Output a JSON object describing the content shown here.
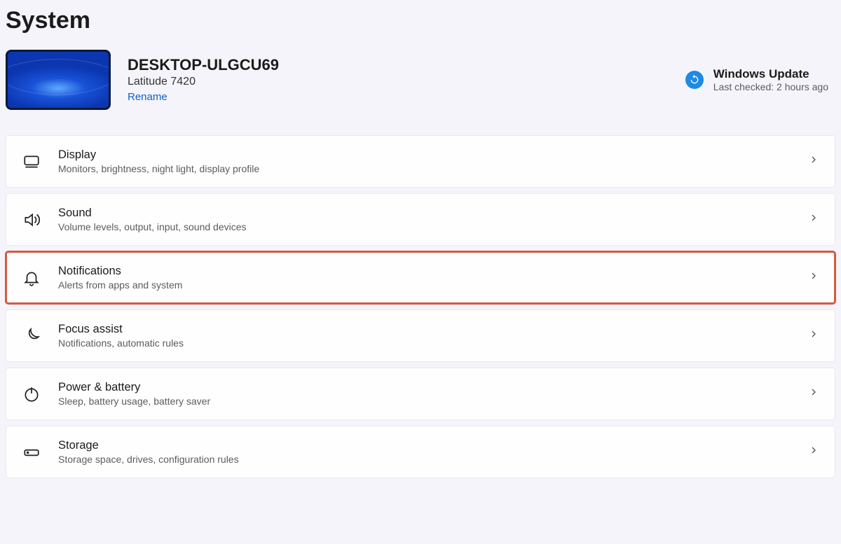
{
  "page_title": "System",
  "device": {
    "name": "DESKTOP-ULGCU69",
    "model": "Latitude 7420",
    "rename_label": "Rename"
  },
  "windows_update": {
    "title": "Windows Update",
    "subtitle": "Last checked: 2 hours ago"
  },
  "highlighted_row_index": 2,
  "rows": [
    {
      "icon": "monitor-icon",
      "title": "Display",
      "subtitle": "Monitors, brightness, night light, display profile"
    },
    {
      "icon": "sound-icon",
      "title": "Sound",
      "subtitle": "Volume levels, output, input, sound devices"
    },
    {
      "icon": "bell-icon",
      "title": "Notifications",
      "subtitle": "Alerts from apps and system"
    },
    {
      "icon": "moon-icon",
      "title": "Focus assist",
      "subtitle": "Notifications, automatic rules"
    },
    {
      "icon": "power-icon",
      "title": "Power & battery",
      "subtitle": "Sleep, battery usage, battery saver"
    },
    {
      "icon": "storage-icon",
      "title": "Storage",
      "subtitle": "Storage space, drives, configuration rules"
    }
  ]
}
